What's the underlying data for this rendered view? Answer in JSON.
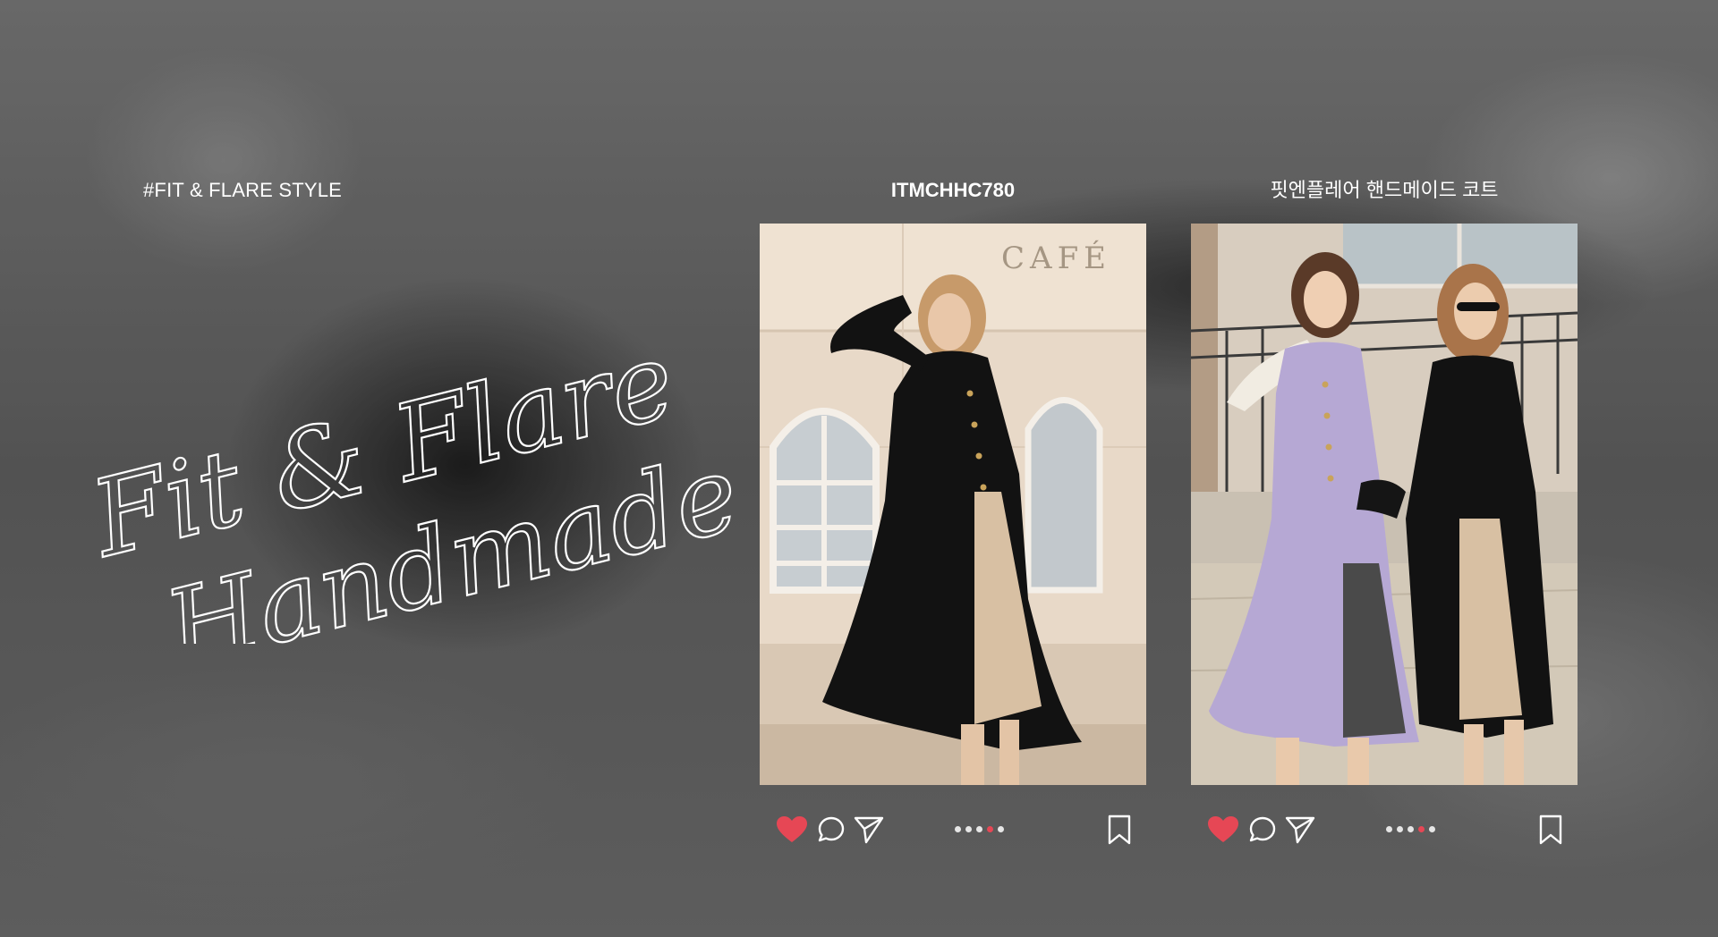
{
  "hashtag": "#FIT & FLARE STYLE",
  "script_title": {
    "line1": "Fit & Flare",
    "line2": "Handmade Coat"
  },
  "cards": [
    {
      "title": "ITMCHHC780",
      "photo_sign": "CAFÉ",
      "icons": [
        "heart-icon",
        "comment-icon",
        "send-icon",
        "bookmark-icon"
      ],
      "carousel": {
        "total": 5,
        "active": 4
      }
    },
    {
      "title": "핏엔플레어 핸드메이드 코트",
      "icons": [
        "heart-icon",
        "comment-icon",
        "send-icon",
        "bookmark-icon"
      ],
      "carousel": {
        "total": 5,
        "active": 4
      }
    }
  ],
  "colors": {
    "like": "#e64755",
    "dot_inactive": "#e6e6e6",
    "dot_active": "#e64755",
    "text": "#ffffff"
  }
}
